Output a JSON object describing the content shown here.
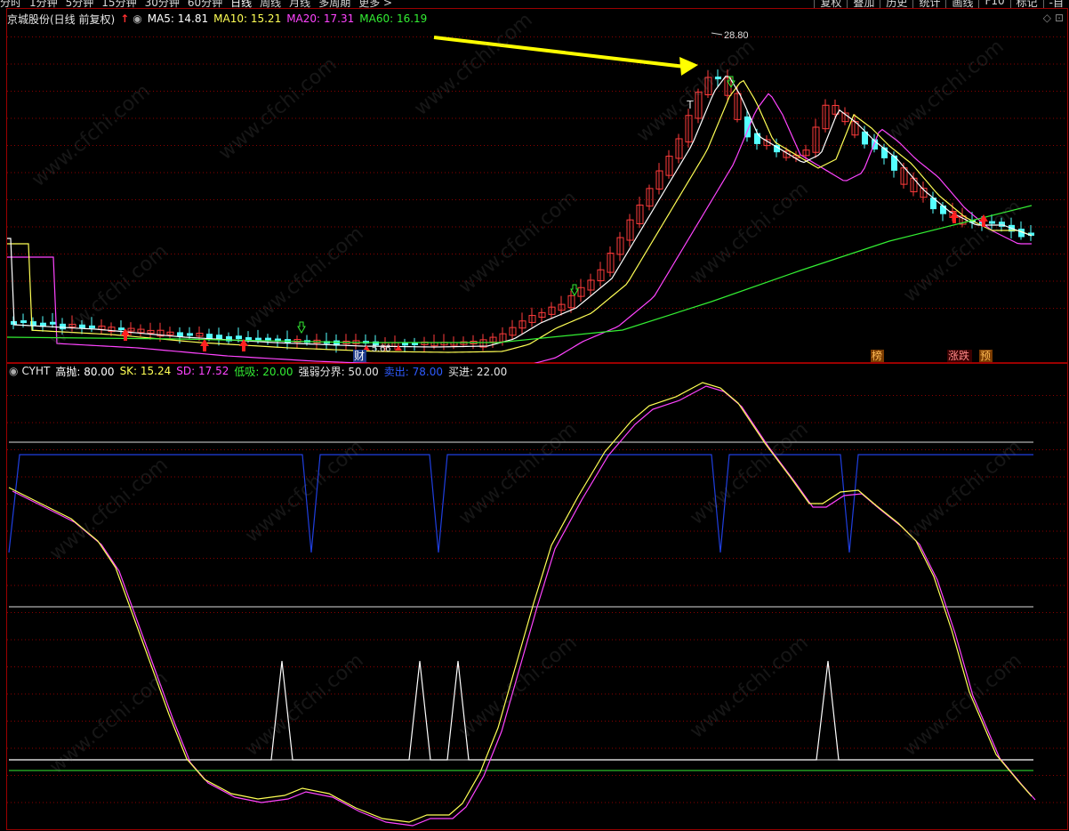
{
  "toolbar": {
    "periods": [
      "分时",
      "1分钟",
      "5分钟",
      "15分钟",
      "30分钟",
      "60分钟",
      "日线",
      "周线",
      "月线",
      "多周期",
      "更多 >"
    ],
    "active_period": "日线",
    "right_buttons": [
      "复权",
      "叠加",
      "历史",
      "统计",
      "画线",
      "F10",
      "标记",
      "-自"
    ]
  },
  "main_header": {
    "title": "京城股份(日线 前复权)",
    "ma5": "MA5: 14.81",
    "ma10": "MA10: 15.21",
    "ma20": "MA20: 17.31",
    "ma60": "MA60: 16.19"
  },
  "sub_header": {
    "name": "CYHT",
    "high": "高抛: 80.00",
    "sk": "SK: 15.24",
    "sd": "SD: 17.52",
    "low": "低吸: 20.00",
    "mid": "强弱分界: 50.00",
    "sell": "卖出: 78.00",
    "buy": "买进: 22.00"
  },
  "annotations": {
    "high_price": "28.80",
    "low_price": "5.66",
    "tag_cai": "财",
    "tag_bang": "榜",
    "tag_zhangdie": "涨跌",
    "tag_yu": "预",
    "t_marker": "T"
  },
  "watermark": "www.cfchi.com",
  "colors": {
    "up": "#ff3b3b",
    "down": "#54ffff",
    "ma5": "#ffffff",
    "ma10": "#ffff55",
    "ma20": "#ff44ff",
    "ma60": "#33ee33",
    "grid": "#8b0000",
    "sk": "#ffff55",
    "sd": "#ff44ff",
    "signal": "#1f3fe0"
  }
}
